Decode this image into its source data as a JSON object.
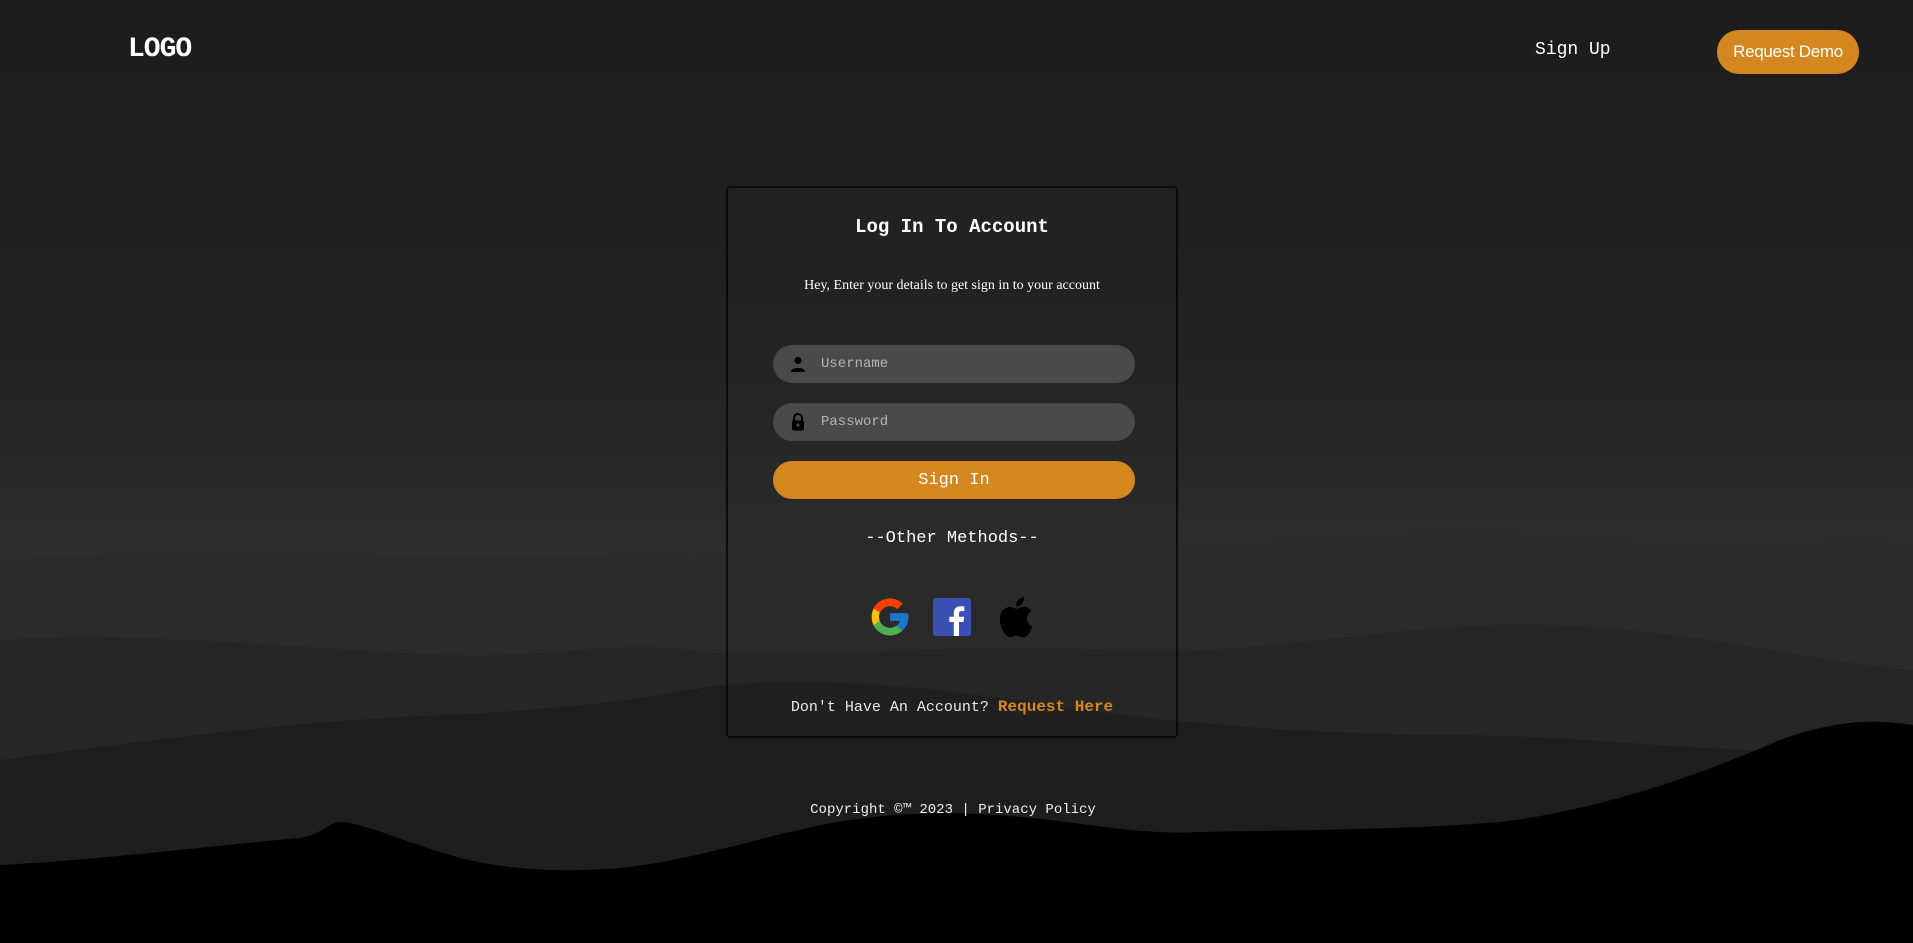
{
  "header": {
    "logo": "LOGO",
    "signup_label": "Sign Up",
    "demo_label": "Request Demo"
  },
  "login": {
    "title": "Log In To Account",
    "subtitle": "Hey, Enter your details to get sign in to your account",
    "username_placeholder": "Username",
    "password_placeholder": "Password",
    "signin_label": "Sign In",
    "other_methods": "--Other Methods--",
    "no_account_text": "Don't Have An Account?",
    "request_link": "Request Here",
    "social_icons": [
      "google-icon",
      "facebook-icon",
      "apple-icon"
    ]
  },
  "footer": {
    "copyright": "Copyright ©™ 2023 |",
    "privacy": "Privacy Policy"
  },
  "colors": {
    "accent": "#d4871f",
    "field_bg": "#4a4a4a",
    "facebook": "#3b4fb4"
  }
}
